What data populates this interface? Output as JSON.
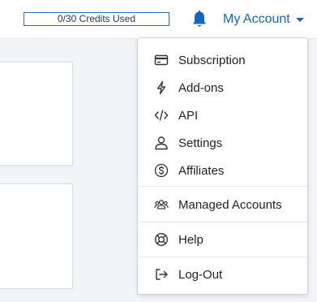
{
  "header": {
    "credits_text": "0/30 Credits Used",
    "account_label": "My Account",
    "icons": {
      "notifications": "bell-icon",
      "account_dropdown": "caret-down-icon"
    }
  },
  "colors": {
    "accent": "#1565c0",
    "credits_border": "#2a6ebd"
  },
  "menu": {
    "items": [
      {
        "label": "Subscription",
        "icon": "credit-card-icon"
      },
      {
        "label": "Add-ons",
        "icon": "bolt-icon"
      },
      {
        "label": "API",
        "icon": "code-icon"
      },
      {
        "label": "Settings",
        "icon": "user-icon"
      },
      {
        "label": "Affiliates",
        "icon": "dollar-circle-icon"
      },
      {
        "label": "Managed Accounts",
        "icon": "users-icon"
      },
      {
        "label": "Help",
        "icon": "life-ring-icon"
      },
      {
        "label": "Log-Out",
        "icon": "sign-out-icon"
      }
    ]
  }
}
